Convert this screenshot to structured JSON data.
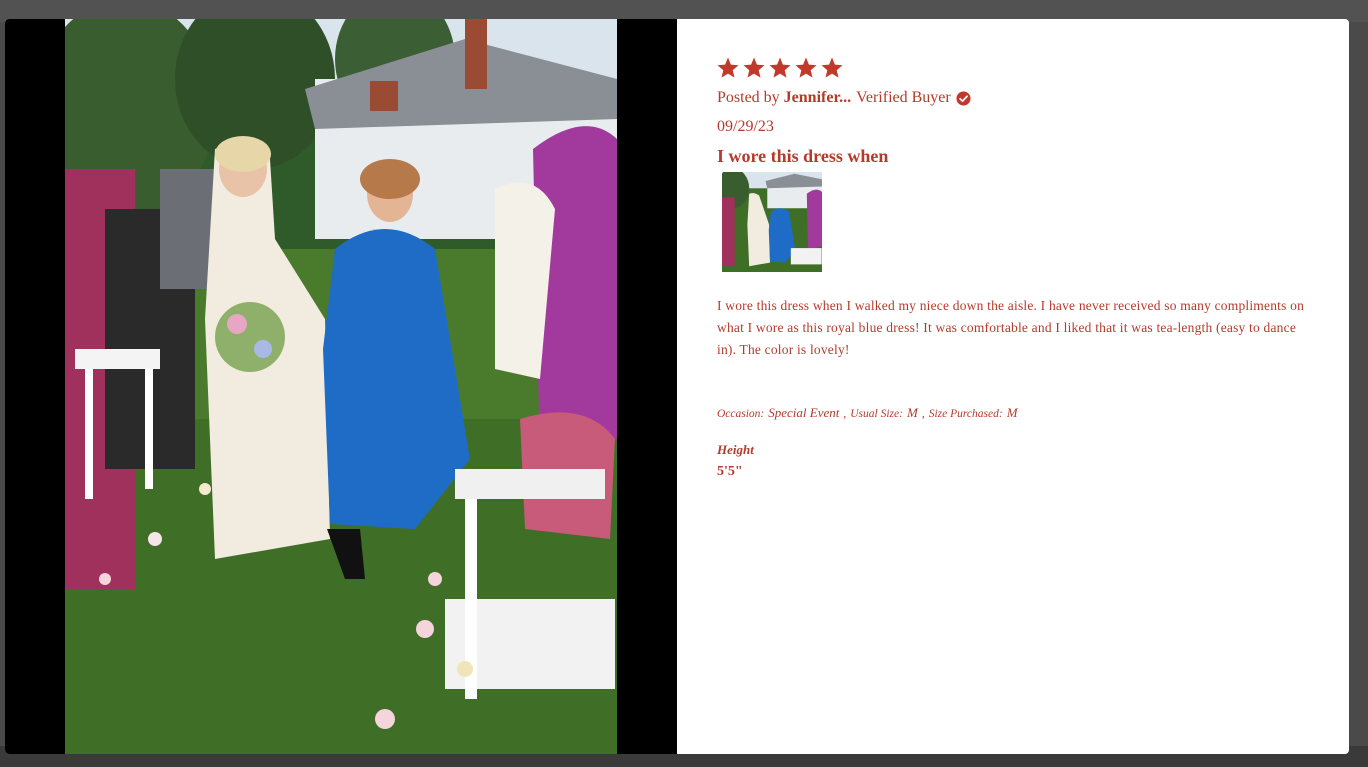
{
  "review": {
    "rating": 5,
    "rating_max": 5,
    "posted_by_prefix": "Posted by",
    "author": "Jennifer...",
    "verified_label": "Verified Buyer",
    "date": "09/29/23",
    "title": "I wore this dress when",
    "body": "I wore this dress when I walked my niece down the aisle. I have never received so many compliments on what I wore as this royal blue dress! It was comfortable and I liked that it was tea-length (easy to dance in). The color is lovely!",
    "attributes": [
      {
        "label": "Occasion:",
        "value": "Special Event",
        "sep": ","
      },
      {
        "label": "Usual Size:",
        "value": "M",
        "sep": ","
      },
      {
        "label": "Size Purchased:",
        "value": "M",
        "sep": ""
      }
    ],
    "height_label": "Height",
    "height_value": "5'5\""
  },
  "media": {
    "main_photo_icon": "wedding-photo",
    "thumbnail_icon": "wedding-photo-thumbnail"
  },
  "colors": {
    "accent": "#c0392b",
    "backdrop": "#4a4a4a",
    "media_background": "#000000"
  }
}
